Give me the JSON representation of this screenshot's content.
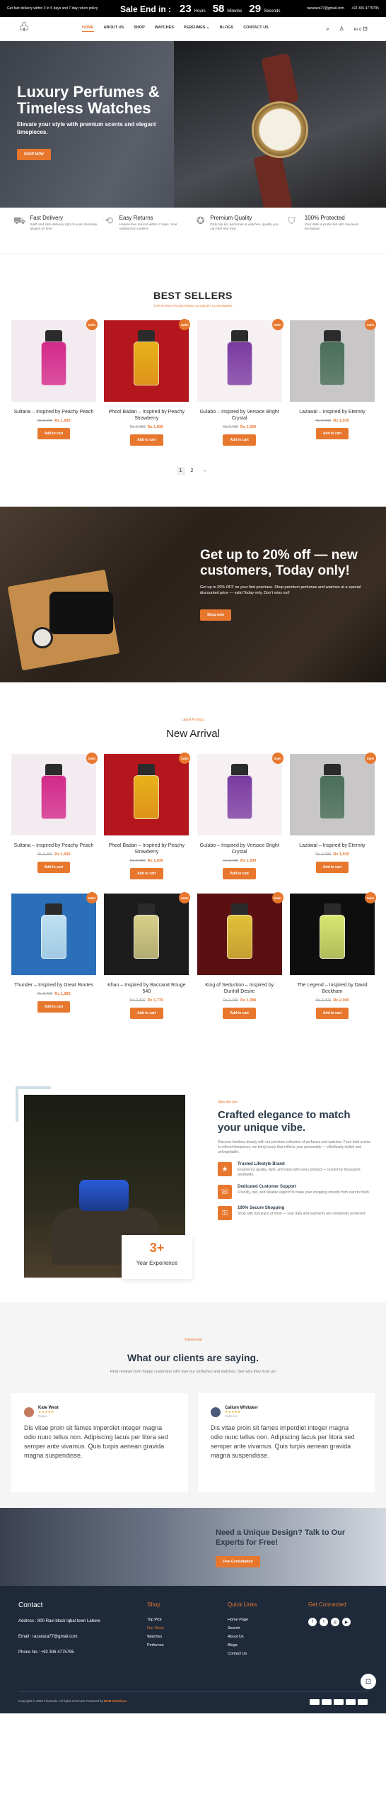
{
  "topbar": {
    "left": "Get fast delivery within 3 to 5 days and 7-day return policy",
    "sale_label": "Sale End in :",
    "hours": "23",
    "hours_u": "Hours",
    "minutes": "58",
    "minutes_u": "Minutes",
    "seconds": "29",
    "seconds_u": "Seconds",
    "email": "razaraza77@gmail.com",
    "phone": "+92 306 4775795"
  },
  "nav": {
    "items": [
      "HOME",
      "ABOUT US",
      "SHOP",
      "WATCHES",
      "PERFUMES",
      "BLOGS",
      "CONTACT US"
    ],
    "cart": "Rs 0"
  },
  "hero": {
    "title": "Luxury Perfumes & Timeless Watches",
    "text": "Elevate your style with premium scents and elegant timepieces.",
    "button": "SHOP NOW"
  },
  "features": [
    {
      "icon": "truck-icon",
      "title": "Fast Delivery",
      "text": "Swift and safe delivery right to your doorstep, always on time"
    },
    {
      "icon": "return-icon",
      "title": "Easy Returns",
      "text": "Hassle-free returns within 7 days. Your satisfaction matters"
    },
    {
      "icon": "award-icon",
      "title": "Premium Quality",
      "text": "Only top-tier perfumes & watches, quality you can feel and trust"
    },
    {
      "icon": "shield-icon",
      "title": "100% Protected",
      "text": "Your data is protected with top-level encryption"
    }
  ],
  "bestsellers": {
    "title": "BEST SELLERS",
    "subtitle": "TOP RATED FRAGRANCES LOVED BY CUSTOMERS",
    "badge": "Sale!",
    "add": "Add to cart",
    "products": [
      {
        "name": "Sultana – Inspired by Peachy Peach",
        "old": "Rs 2,400",
        "new": "Rs 1,930",
        "bg": "#f2ecf0",
        "liquid": "#d3298a"
      },
      {
        "name": "Phool Badan – Inspired by Peachy Strawberry",
        "old": "Rs 2,400",
        "new": "Rs 1,930",
        "bg": "#b3161c",
        "liquid": "#e8b21a"
      },
      {
        "name": "Gulabo – Inspired by Versace Bright Crystal",
        "old": "Rs 2,400",
        "new": "Rs 1,930",
        "bg": "#f6f0f3",
        "liquid": "#7a3aa0"
      },
      {
        "name": "Lazawal – Inspired by Eternity",
        "old": "Rs 2,400",
        "new": "Rs 1,930",
        "bg": "#c9c6c8",
        "liquid": "#4a6e5a"
      }
    ],
    "pages": [
      "1",
      "2",
      "→"
    ]
  },
  "promo": {
    "title": "Get up to 20% off — new customers, Today only!",
    "text": "Get up to 20% OFF on your first purchase. Shop premium perfumes and watches at a special discounted price — valid Today only. Don’t miss out!",
    "button": "Shop now"
  },
  "newarrival": {
    "sub": "Latest Product",
    "title": "New Arrival",
    "badge": "Sale!",
    "add": "Add to cart",
    "row1": [
      {
        "name": "Sultana – Inspired by Peachy Peach",
        "old": "Rs 2,400",
        "new": "Rs 1,930",
        "bg": "#f2ecf0",
        "liquid": "#d3298a"
      },
      {
        "name": "Phool Badan – Inspired by Peachy Strawberry",
        "old": "Rs 2,400",
        "new": "Rs 1,930",
        "bg": "#b3161c",
        "liquid": "#e8b21a"
      },
      {
        "name": "Gulabo – Inspired by Versace Bright Crystal",
        "old": "Rs 2,400",
        "new": "Rs 1,930",
        "bg": "#f6f0f3",
        "liquid": "#7a3aa0"
      },
      {
        "name": "Lazawal – Inspired by Eternity",
        "old": "Rs 2,400",
        "new": "Rs 1,930",
        "bg": "#c9c6c8",
        "liquid": "#4a6e5a"
      }
    ],
    "row2": [
      {
        "name": "Thunder – Inspired by Great Routes",
        "old": "Rs 2,400",
        "new": "Rs 1,080",
        "bg": "#2a6fb8",
        "liquid": "#bfe0f0"
      },
      {
        "name": "Khan – Inspired by Baccarat Rouge 540",
        "old": "Rs 2,400",
        "new": "Rs 1,770",
        "bg": "#1c1c1c",
        "liquid": "#d8d08a"
      },
      {
        "name": "King of Seduction – Inspired by Dunhill Desire",
        "old": "Rs 2,400",
        "new": "Rs 1,080",
        "bg": "#5a1010",
        "liquid": "#e2c23a"
      },
      {
        "name": "The Legend – Inspired by David Beckham",
        "old": "Rs 2,400",
        "new": "Rs 2,000",
        "bg": "#0e0e0e",
        "liquid": "#d8e870"
      }
    ]
  },
  "about": {
    "sm": "Who We Are",
    "title": "Crafted elegance to match your unique vibe.",
    "lead": "Discover timeless beauty with our premium collection of perfumes and watches. From bold scents to refined timepieces, we bring luxury that reflects your personality — effortlessly stylish and unforgettable.",
    "years": "3+",
    "years_label": "Year Experience",
    "items": [
      {
        "title": "Trusted Lifestyle Brand",
        "text": "Experience quality, style, and class with every product — trusted by thousands worldwide."
      },
      {
        "title": "Dedicated Customer Support",
        "text": "Friendly, fast, and reliable support to make your shopping smooth from start to finish."
      },
      {
        "title": "100% Secure Shopping",
        "text": "Shop with full peace of mind — your data and payments are completely protected."
      }
    ]
  },
  "testimonials": {
    "sm": "Testimonial",
    "title": "What our clients are saying.",
    "lead": "Real reviews from happy customers who love our perfumes and watches. See why they trust us!",
    "items": [
      {
        "name": "Kate West",
        "stars": "★★★★★",
        "role": "Paguo",
        "text": "Dis vitae proin sit fames imperdiet integer magna odio nunc tellus non. Adipiscing lacus per litora sed semper ante vivamus. Quis turpis aenean gravida magna suspendisse."
      },
      {
        "name": "Callum Whitaker",
        "stars": "★★★★★",
        "role": "Sabarina",
        "text": "Dis vitae proin sit fames imperdiet integer magna odio nunc tellus non. Adipiscing lacus per litora sed semper ante vivamus. Quis turpis aenean gravida magna suspendisse."
      }
    ]
  },
  "cta": {
    "title": "Need a Unique Design? Talk to Our Experts for Free!",
    "button": "Free Consultation"
  },
  "footer": {
    "contact_title": "Contact",
    "address": "Address : 800 Ravi block Iqbal town Lahore",
    "email": "Email : razaraza77@gmail.com",
    "phone": "Phone No : +92 306 4775795",
    "shop_title": "Shop",
    "shop": [
      "Top Pick",
      "Our Shop",
      "Watches",
      "Perfumes"
    ],
    "quick_title": "Quick Links",
    "quick": [
      "Home Page",
      "Search",
      "About Us",
      "Blogs",
      "Contact Us"
    ],
    "connect_title": "Get Connected",
    "copyright": "Copyright © 2025 Tinasonic. All rights reserved. Powered by",
    "powered": "BDM Solutions"
  },
  "colors": {
    "accent": "#e8772e",
    "dark": "#1e2a3a"
  }
}
